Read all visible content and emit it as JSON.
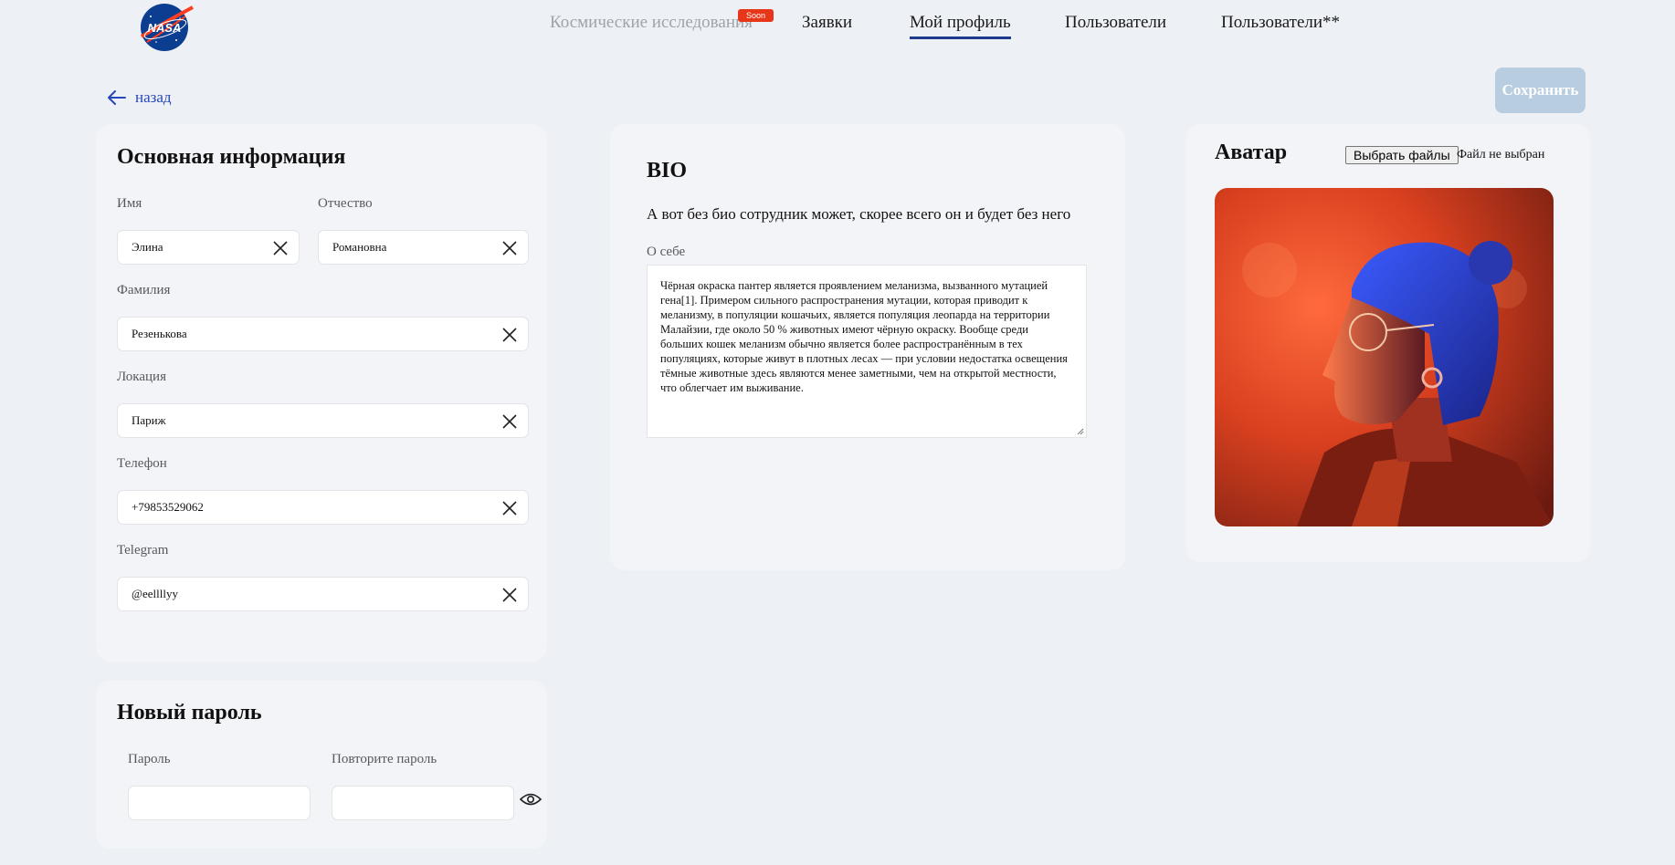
{
  "brand": {
    "logo_text": "NASA"
  },
  "nav": {
    "items": [
      {
        "label": "Космические исследования",
        "badge": "Soon",
        "state": "disabled"
      },
      {
        "label": "Заявки",
        "state": "normal"
      },
      {
        "label": "Мой профиль",
        "state": "active"
      },
      {
        "label": "Пользователи",
        "state": "normal"
      },
      {
        "label": "Пользователи**",
        "state": "normal"
      }
    ]
  },
  "toolbar": {
    "back_label": "назад",
    "save_label": "Сохранить"
  },
  "main_info": {
    "title": "Основная информация",
    "fields": {
      "first_name": {
        "label": "Имя",
        "value": "Элина"
      },
      "patronymic": {
        "label": "Отчество",
        "value": "Романовна"
      },
      "last_name": {
        "label": "Фамилия",
        "value": "Резенькова"
      },
      "location": {
        "label": "Локация",
        "value": "Париж"
      },
      "phone": {
        "label": "Телефон",
        "value": "+79853529062"
      },
      "telegram": {
        "label": "Telegram",
        "value": "@eellllyy"
      }
    }
  },
  "password": {
    "title": "Новый пароль",
    "password_label": "Пароль",
    "repeat_label": "Повторите пароль",
    "password_value": "",
    "repeat_value": ""
  },
  "bio": {
    "title": "BIO",
    "subtitle": "А вот без био сотрудник может, скорее всего он и будет без него",
    "about_label": "О себе",
    "about_text": "Чёрная окраска пантер является проявлением меланизма, вызванного мутацией гена[1]. Примером сильного распространения мутации, которая приводит к меланизму, в популяции кошачьих, является популяция леопарда на территории Малайзии, где около 50 % животных имеют чёрную окраску. Вообще среди больших кошек меланизм обычно является более распространённым в тех популяциях, которые живут в плотных лесах — при условии недостатка освещения тёмные животные здесь являются менее заметными, чем на открытой местности, что облегчает им выживание."
  },
  "avatar": {
    "title": "Аватар",
    "file_button": "Выбрать файлы",
    "file_status": "Файл не выбран"
  },
  "colors": {
    "background": "#edf0f5",
    "card": "#f3f4f7",
    "accent": "#1e3a8a",
    "link": "#2747b8",
    "badge": "#e8361a",
    "save_disabled": "#b8cde0"
  },
  "icons": [
    "nasa-logo",
    "back-arrow-icon",
    "clear-icon",
    "eye-icon"
  ]
}
